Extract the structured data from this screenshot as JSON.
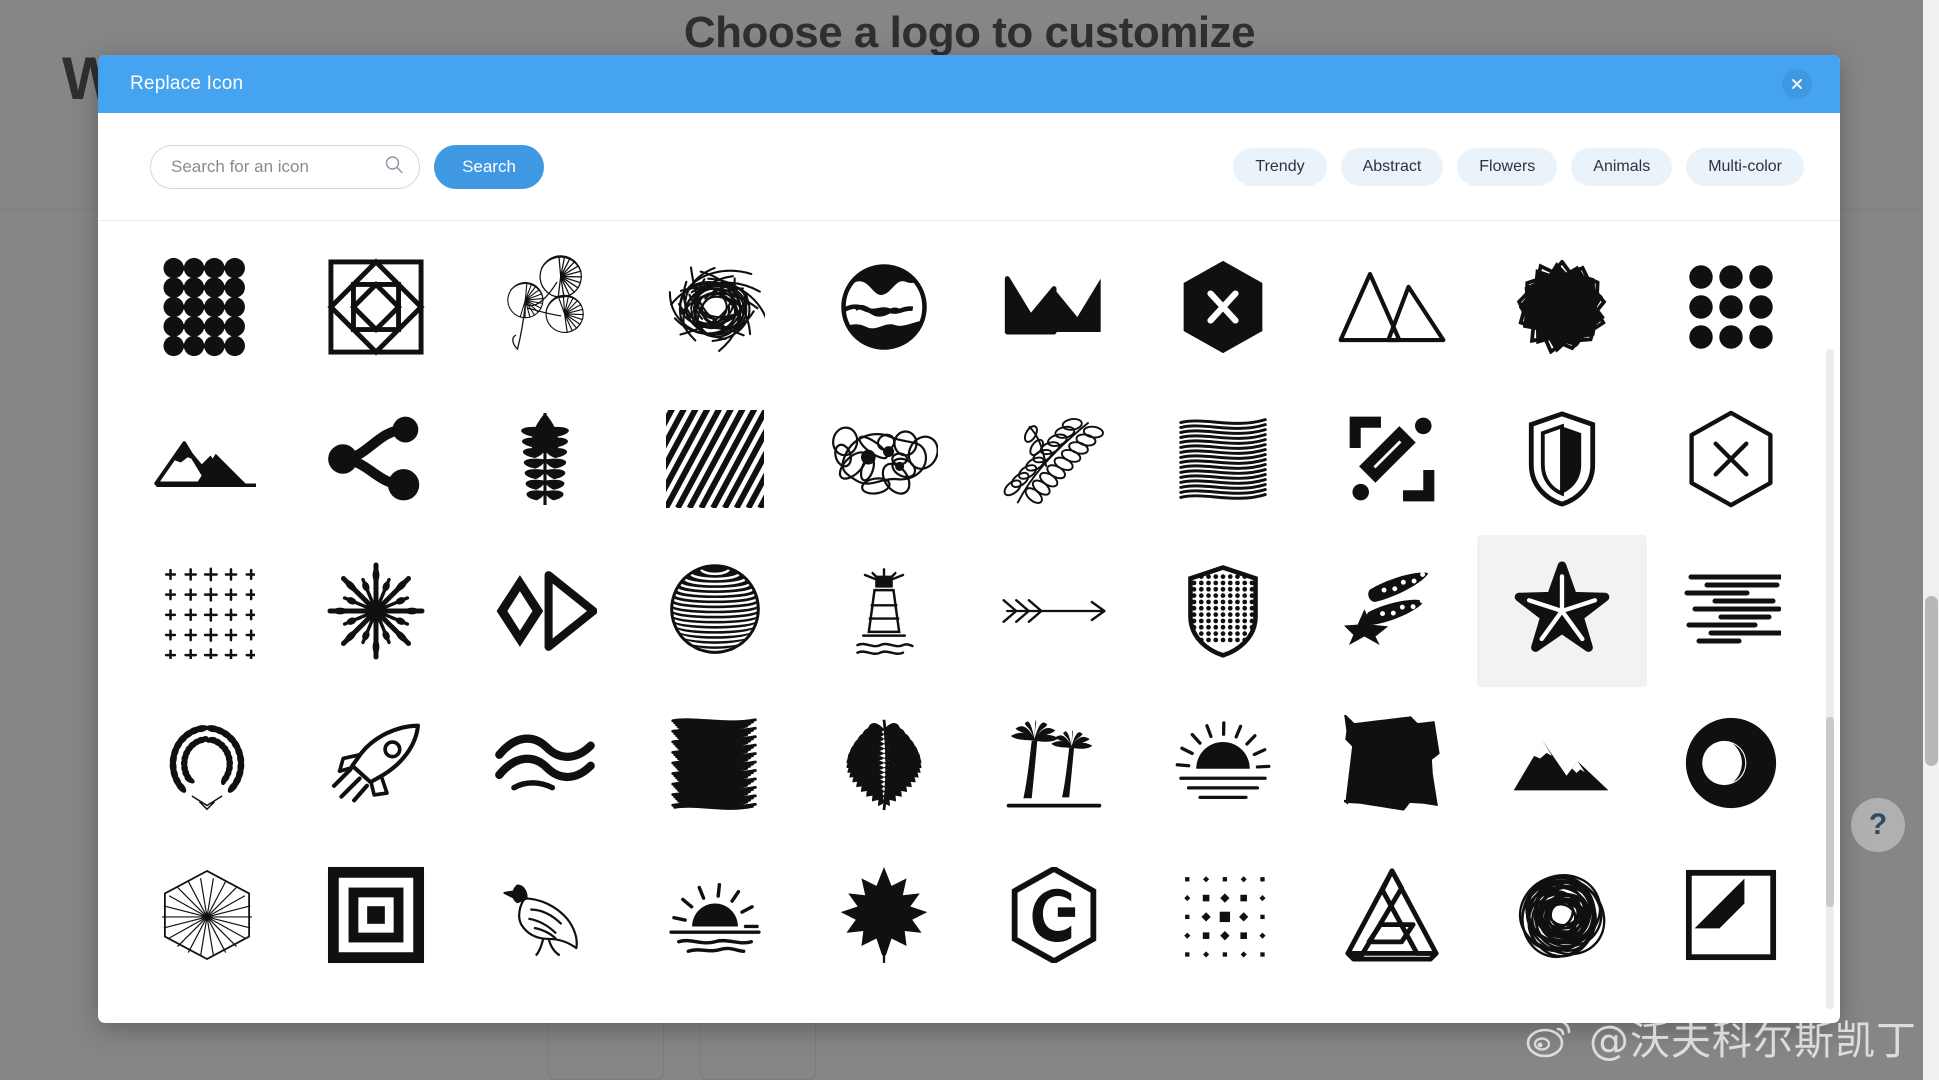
{
  "background": {
    "page_title": "Choose a logo to customize",
    "left_word": "W"
  },
  "modal": {
    "title": "Replace Icon",
    "close_icon": "close-icon",
    "header_color": "#46a3ef",
    "accent_color": "#3f98e2"
  },
  "toolbar": {
    "search_placeholder": "Search for an icon",
    "search_value": "",
    "search_icon": "search-icon",
    "search_button_label": "Search",
    "chips": [
      {
        "label": "Trendy"
      },
      {
        "label": "Abstract"
      },
      {
        "label": "Flowers"
      },
      {
        "label": "Animals"
      },
      {
        "label": "Multi-color"
      }
    ],
    "chip_background": "#eaf2fa"
  },
  "grid": {
    "columns": 10,
    "selected_index": 28,
    "selected_background": "#f2f2f2",
    "icons": [
      {
        "name": "polka-dot-pattern-icon"
      },
      {
        "name": "nested-square-diamond-icon"
      },
      {
        "name": "fern-branch-icon"
      },
      {
        "name": "scribble-blob-icon"
      },
      {
        "name": "globe-landscape-circle-icon"
      },
      {
        "name": "crown-icon"
      },
      {
        "name": "hexagon-x-icon"
      },
      {
        "name": "double-triangle-mountain-icon"
      },
      {
        "name": "wax-seal-blob-icon"
      },
      {
        "name": "nine-dot-grid-icon"
      },
      {
        "name": "mountain-range-icon"
      },
      {
        "name": "molecule-nodes-icon"
      },
      {
        "name": "leaf-frond-icon"
      },
      {
        "name": "diagonal-stripes-square-icon"
      },
      {
        "name": "liquid-splash-icon"
      },
      {
        "name": "olive-branch-icon"
      },
      {
        "name": "scribble-lines-icon"
      },
      {
        "name": "bracket-corners-icon"
      },
      {
        "name": "shield-split-icon"
      },
      {
        "name": "hexagon-outline-x-icon"
      },
      {
        "name": "plus-dot-grid-icon"
      },
      {
        "name": "starburst-flower-icon"
      },
      {
        "name": "double-chevron-diamond-icon"
      },
      {
        "name": "striped-sphere-icon"
      },
      {
        "name": "lighthouse-icon"
      },
      {
        "name": "triple-arrow-right-icon"
      },
      {
        "name": "dotted-shield-icon"
      },
      {
        "name": "shooting-star-icon"
      },
      {
        "name": "nautical-star-icon"
      },
      {
        "name": "speed-lines-icon"
      },
      {
        "name": "laurel-wreath-icon"
      },
      {
        "name": "rocket-icon"
      },
      {
        "name": "wave-swoosh-icon"
      },
      {
        "name": "scribble-square-icon"
      },
      {
        "name": "palm-frond-icon"
      },
      {
        "name": "palm-trees-icon"
      },
      {
        "name": "sunrise-rays-icon"
      },
      {
        "name": "rough-filled-square-icon"
      },
      {
        "name": "mountain-peaks-icon"
      },
      {
        "name": "circle-crescent-icon"
      },
      {
        "name": "hexagon-starburst-icon"
      },
      {
        "name": "concentric-squares-icon"
      },
      {
        "name": "eagle-icon"
      },
      {
        "name": "sunset-water-icon"
      },
      {
        "name": "maple-leaf-icon"
      },
      {
        "name": "hexagon-c-monogram-icon"
      },
      {
        "name": "square-dot-matrix-icon"
      },
      {
        "name": "penrose-triangle-icon"
      },
      {
        "name": "scribble-circle-icon"
      },
      {
        "name": "square-diagonal-fold-icon"
      }
    ]
  },
  "help": {
    "label": "?"
  },
  "watermark": {
    "handle": "@沃夫科尔斯凯丁",
    "platform_icon": "weibo-icon"
  }
}
